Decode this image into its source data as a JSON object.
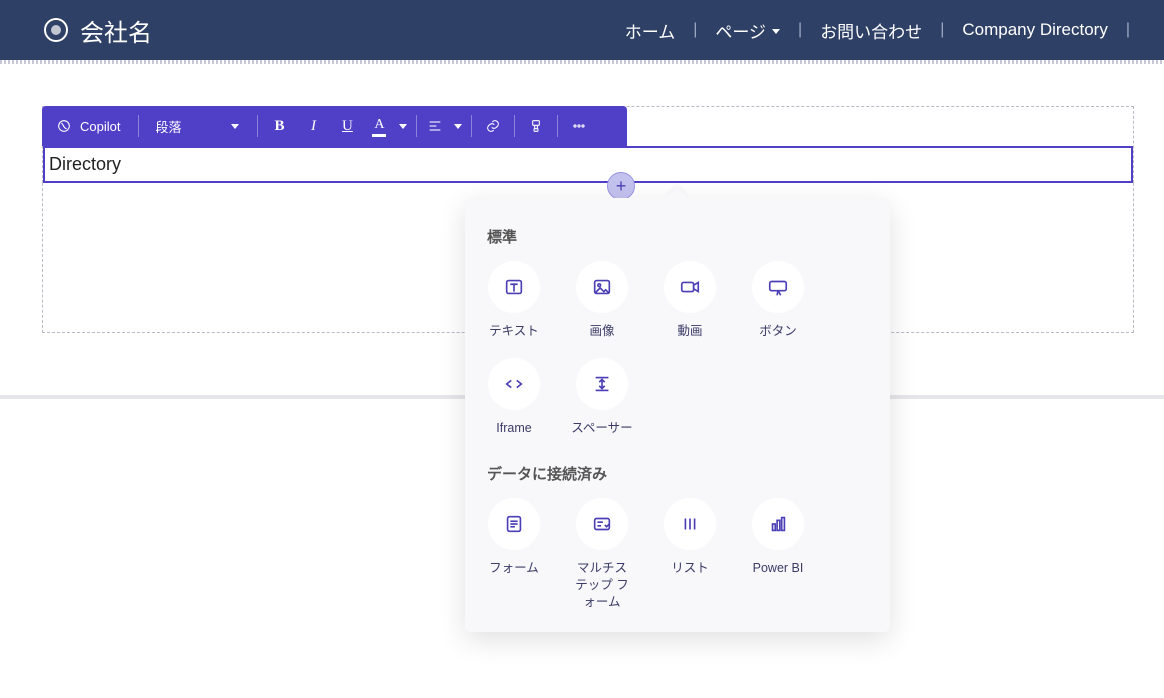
{
  "navbar": {
    "brand": "会社名",
    "links": {
      "home": "ホーム",
      "pages": "ページ",
      "contact": "お問い合わせ",
      "directory": "Company Directory"
    }
  },
  "toolbar": {
    "copilot": "Copilot",
    "paragraph": "段落",
    "bold": "B",
    "italic": "I",
    "underline": "U",
    "font_color_letter": "A"
  },
  "editor": {
    "heading_text": "Directory"
  },
  "add_button": {
    "plus": "+"
  },
  "popover": {
    "section_standard": "標準",
    "section_connected": "データに接続済み",
    "items_standard": [
      {
        "id": "text",
        "label": "テキスト"
      },
      {
        "id": "image",
        "label": "画像"
      },
      {
        "id": "video",
        "label": "動画"
      },
      {
        "id": "button",
        "label": "ボタン"
      },
      {
        "id": "iframe",
        "label": "Iframe"
      },
      {
        "id": "spacer",
        "label": "スペーサー"
      }
    ],
    "items_connected": [
      {
        "id": "form",
        "label": "フォーム"
      },
      {
        "id": "multistep",
        "label": "マルチステップ フォーム"
      },
      {
        "id": "list",
        "label": "リスト"
      },
      {
        "id": "powerbi",
        "label": "Power BI"
      }
    ]
  }
}
